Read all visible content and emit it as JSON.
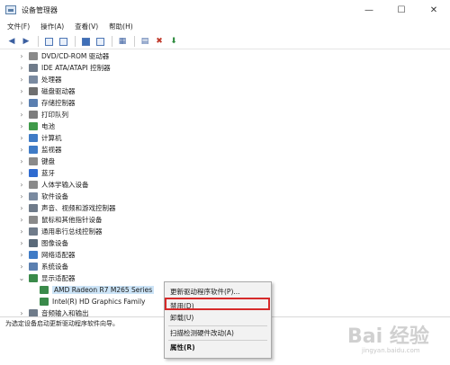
{
  "window": {
    "title": "设备管理器"
  },
  "window_buttons": [
    "—",
    "☐",
    "✕"
  ],
  "menubar": [
    "文件(F)",
    "操作(A)",
    "查看(V)",
    "帮助(H)"
  ],
  "tree": [
    {
      "label": "DVD/CD-ROM 驱动器",
      "icon": "dvd-drive-icon",
      "color": "#8a8a8a"
    },
    {
      "label": "IDE ATA/ATAPI 控制器",
      "icon": "ide-controller-icon",
      "color": "#6f7b8a"
    },
    {
      "label": "处理器",
      "icon": "processor-icon",
      "color": "#7a8aa0"
    },
    {
      "label": "磁盘驱动器",
      "icon": "disk-drive-icon",
      "color": "#6f6f6f"
    },
    {
      "label": "存储控制器",
      "icon": "storage-controller-icon",
      "color": "#5a7fb0"
    },
    {
      "label": "打印队列",
      "icon": "printer-icon",
      "color": "#7d7d7d"
    },
    {
      "label": "电池",
      "icon": "battery-icon",
      "color": "#3f9a4a"
    },
    {
      "label": "计算机",
      "icon": "computer-icon",
      "color": "#3f7bc6"
    },
    {
      "label": "监视器",
      "icon": "monitor-icon",
      "color": "#3f7bc6"
    },
    {
      "label": "键盘",
      "icon": "keyboard-icon",
      "color": "#8a8a8a"
    },
    {
      "label": "蓝牙",
      "icon": "bluetooth-icon",
      "color": "#2f6bd0"
    },
    {
      "label": "人体学输入设备",
      "icon": "hid-icon",
      "color": "#8a8a8a"
    },
    {
      "label": "软件设备",
      "icon": "software-device-icon",
      "color": "#7a8aa0"
    },
    {
      "label": "声音、视频和游戏控制器",
      "icon": "sound-icon",
      "color": "#6f7b8a"
    },
    {
      "label": "鼠标和其他指针设备",
      "icon": "mouse-icon",
      "color": "#8a8a8a"
    },
    {
      "label": "通用串行总线控制器",
      "icon": "usb-icon",
      "color": "#6f7b8a"
    },
    {
      "label": "图像设备",
      "icon": "camera-icon",
      "color": "#5a6a7a"
    },
    {
      "label": "网络适配器",
      "icon": "network-adapter-icon",
      "color": "#3f7bc6"
    },
    {
      "label": "系统设备",
      "icon": "system-device-icon",
      "color": "#5a7fb0"
    },
    {
      "label": "显示适配器",
      "icon": "display-adapter-icon",
      "color": "#3a8a4a",
      "expanded": true
    },
    {
      "label": "AMD Radeon R7 M265 Series",
      "icon": "gpu-icon",
      "color": "#3a8a4a",
      "child": true,
      "selected": true
    },
    {
      "label": "Intel(R) HD Graphics Family",
      "icon": "gpu-icon",
      "color": "#3a8a4a",
      "child": true
    },
    {
      "label": "音频输入和输出",
      "icon": "audio-icon",
      "color": "#6f7b8a"
    }
  ],
  "statusbar": {
    "text": "为选定设备启动更新驱动程序软件向导。"
  },
  "context_menu": {
    "update_driver": "更新驱动程序软件(P)...",
    "disable": "禁用(D)",
    "uninstall": "卸载(U)",
    "scan": "扫描检测硬件改动(A)",
    "properties": "属性(R)"
  },
  "watermark": {
    "text": "Bai 经验",
    "sub": "jingyan.baidu.com"
  }
}
